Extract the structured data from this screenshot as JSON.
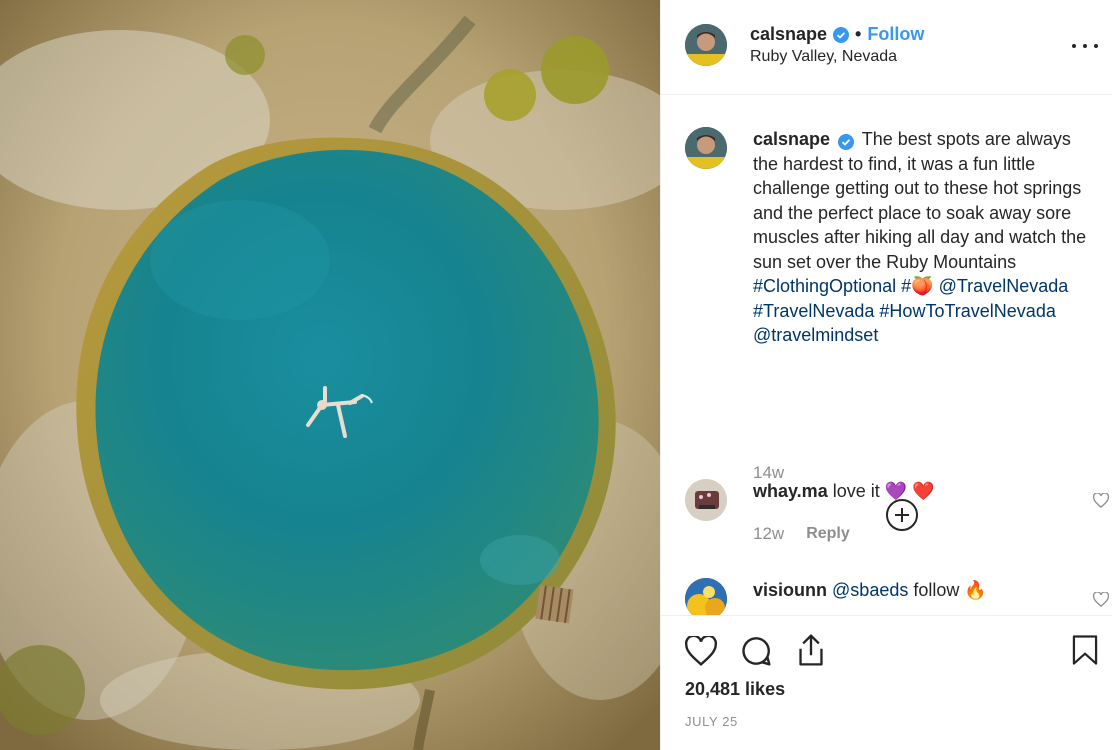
{
  "post": {
    "image_alt": "",
    "author": {
      "username": "calsnape",
      "verified": true,
      "location": "Ruby Valley, Nevada"
    },
    "follow_label": "Follow",
    "separator": "•"
  },
  "caption": {
    "username": "calsnape",
    "text": "The best spots are always the hardest to find, it was a fun little challenge getting out to these hot springs and the perfect place to soak away sore muscles after hiking all day and watch the sun set over the Ruby Mountains",
    "tags": [
      "#ClothingOptional",
      "#🍑",
      "@TravelNevada",
      "#TravelNevada",
      "#HowToTravelNevada",
      "@travelmindset"
    ],
    "time": "14w"
  },
  "comments": [
    {
      "username": "whay.ma",
      "text": "love it 💜 ❤️",
      "time": "12w",
      "reply_label": "Reply"
    },
    {
      "username": "visiounn",
      "mention": "@sbaeds",
      "text": "follow 🔥"
    }
  ],
  "actions": {
    "icons": [
      "heart-icon",
      "comment-icon",
      "share-icon",
      "bookmark-icon"
    ]
  },
  "likes": "20,481 likes",
  "date": "JULY 25",
  "colors": {
    "link": "#003569",
    "follow": "#3897f0",
    "muted": "#8e8e8e",
    "water": "#1b8a96"
  }
}
